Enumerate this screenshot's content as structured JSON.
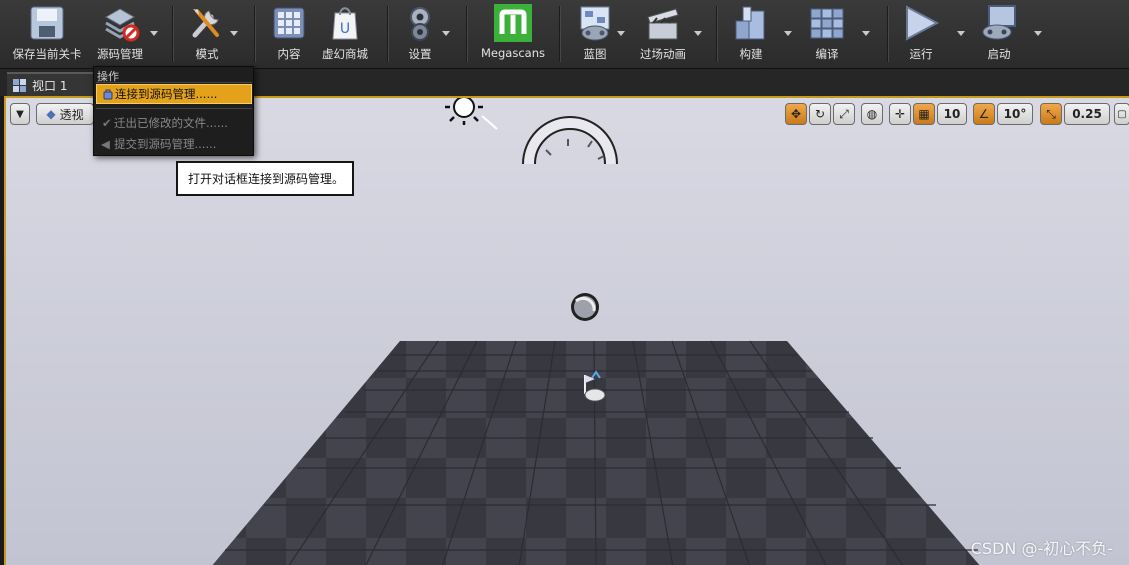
{
  "toolbar": {
    "items": [
      {
        "label": "保存当前关卡",
        "icon": "save-icon"
      },
      {
        "label": "源码管理",
        "icon": "source-control-icon"
      },
      {
        "label": "模式",
        "icon": "modes-icon"
      },
      {
        "label": "内容",
        "icon": "content-browser-icon"
      },
      {
        "label": "虚幻商城",
        "icon": "marketplace-icon"
      },
      {
        "label": "设置",
        "icon": "settings-icon"
      },
      {
        "label": "Megascans",
        "icon": "megascans-icon"
      },
      {
        "label": "蓝图",
        "icon": "blueprint-icon"
      },
      {
        "label": "过场动画",
        "icon": "cinematics-icon"
      },
      {
        "label": "构建",
        "icon": "build-icon"
      },
      {
        "label": "编译",
        "icon": "compile-icon"
      },
      {
        "label": "运行",
        "icon": "play-icon"
      },
      {
        "label": "启动",
        "icon": "launch-icon"
      }
    ]
  },
  "tab": {
    "label": "视口 1",
    "icon": "viewport-icon"
  },
  "viewport": {
    "perspective_label": "透视",
    "grid_snap_value": "10",
    "rotation_snap_value": "10°",
    "scale_snap_value": "0.25",
    "watermark": "CSDN @-初心不负-"
  },
  "menu": {
    "header": "操作",
    "items": [
      {
        "label": "连接到源码管理......",
        "state": "highlighted",
        "icon": "connect-icon"
      },
      {
        "label": "迁出已修改的文件......",
        "state": "disabled",
        "icon": "checkmark-icon"
      },
      {
        "label": "提交到源码管理......",
        "state": "disabled",
        "icon": "submit-arrow-icon"
      }
    ]
  },
  "tooltip": {
    "text": "打开对话框连接到源码管理。"
  },
  "colors": {
    "accent": "#e3a21a",
    "toolbar_bg": "#2e2e2e",
    "megascans_green": "#3bb13b",
    "viewport_sky": "#d3d4df",
    "floor_dark": "#3a3b44"
  }
}
